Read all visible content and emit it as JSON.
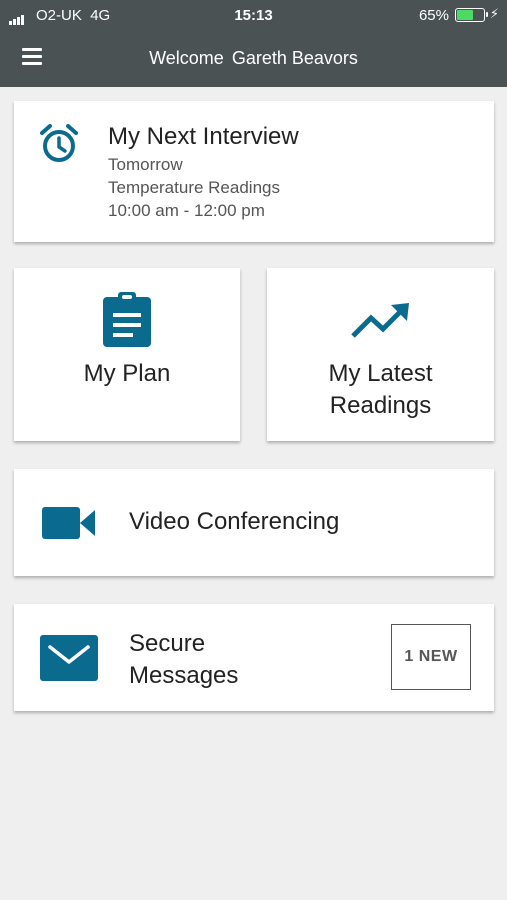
{
  "status_bar": {
    "carrier": "O2-UK",
    "network": "4G",
    "time": "15:13",
    "battery": "65%"
  },
  "header": {
    "welcome": "Welcome",
    "user_name": "Gareth Beavors"
  },
  "next_interview": {
    "title": "My Next Interview",
    "day": "Tomorrow",
    "topic": "Temperature Readings",
    "time_range": "10:00 am - 12:00 pm"
  },
  "tiles": {
    "plan_label": "My Plan",
    "readings_line1": "My Latest",
    "readings_line2": "Readings"
  },
  "video": {
    "label": "Video Conferencing"
  },
  "messages": {
    "line1": "Secure",
    "line2": "Messages",
    "badge": "1 NEW"
  },
  "colors": {
    "accent": "#0b6b8f",
    "header_bg": "#4a5254",
    "page_bg": "#efefef"
  }
}
